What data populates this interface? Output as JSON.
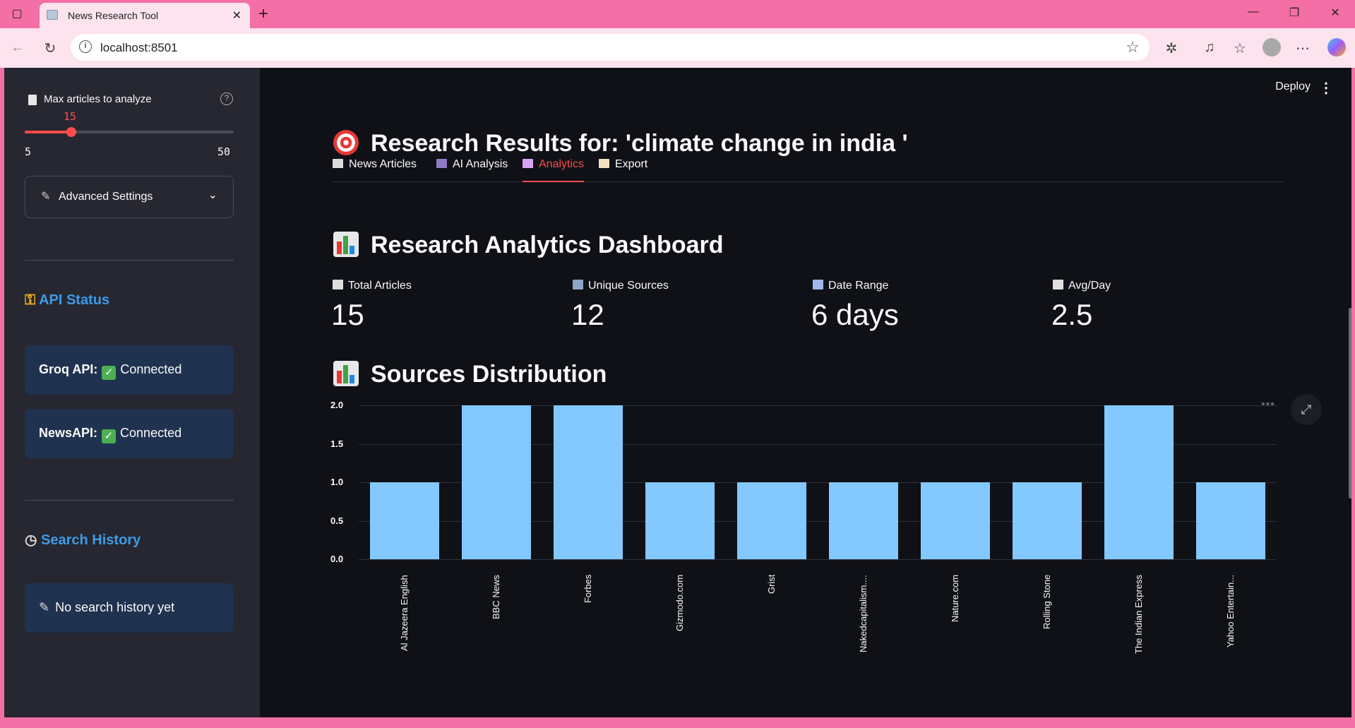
{
  "browser": {
    "tab_title": "News Research Tool",
    "url": "localhost:8501"
  },
  "sidebar": {
    "slider": {
      "label": "Max articles to analyze",
      "value": "15",
      "min": "5",
      "max": "50",
      "fraction": 0.2222
    },
    "advanced_settings_label": "Advanced Settings",
    "api_status": {
      "heading": "API Status",
      "groq_label": "Groq API:",
      "groq_status": "Connected",
      "newsapi_label": "NewsAPI:",
      "newsapi_status": "Connected"
    },
    "search_history": {
      "heading": "Search History",
      "empty_text": "No search history yet"
    }
  },
  "main": {
    "deploy_label": "Deploy",
    "title": "Research Results for: 'climate change in india '",
    "tabs": [
      {
        "label": "News Articles"
      },
      {
        "label": "AI Analysis"
      },
      {
        "label": "Analytics"
      },
      {
        "label": "Export"
      }
    ],
    "dashboard_title": "Research Analytics Dashboard",
    "metrics": [
      {
        "label": "Total Articles",
        "value": "15"
      },
      {
        "label": "Unique Sources",
        "value": "12"
      },
      {
        "label": "Date Range",
        "value": "6 days"
      },
      {
        "label": "Avg/Day",
        "value": "2.5"
      }
    ],
    "chart_title": "Sources Distribution"
  },
  "chart_data": {
    "type": "bar",
    "categories": [
      "Al Jazeera English",
      "BBC News",
      "Forbes",
      "Gizmodo.com",
      "Grist",
      "Nakedcapitalism....",
      "Nature.com",
      "Rolling Stone",
      "The Indian Express",
      "Yahoo Entertain..."
    ],
    "values": [
      1,
      2,
      2,
      1,
      1,
      1,
      1,
      1,
      2,
      1
    ],
    "yticks": [
      "0.0",
      "0.5",
      "1.0",
      "1.5",
      "2.0"
    ],
    "ylim": [
      0,
      2
    ],
    "grid": true,
    "bar_color": "#83c9ff"
  },
  "colors": {
    "accent": "#ff4b4b",
    "sidebar_heading": "#3d9be9",
    "card_bg": "#1f3350"
  }
}
